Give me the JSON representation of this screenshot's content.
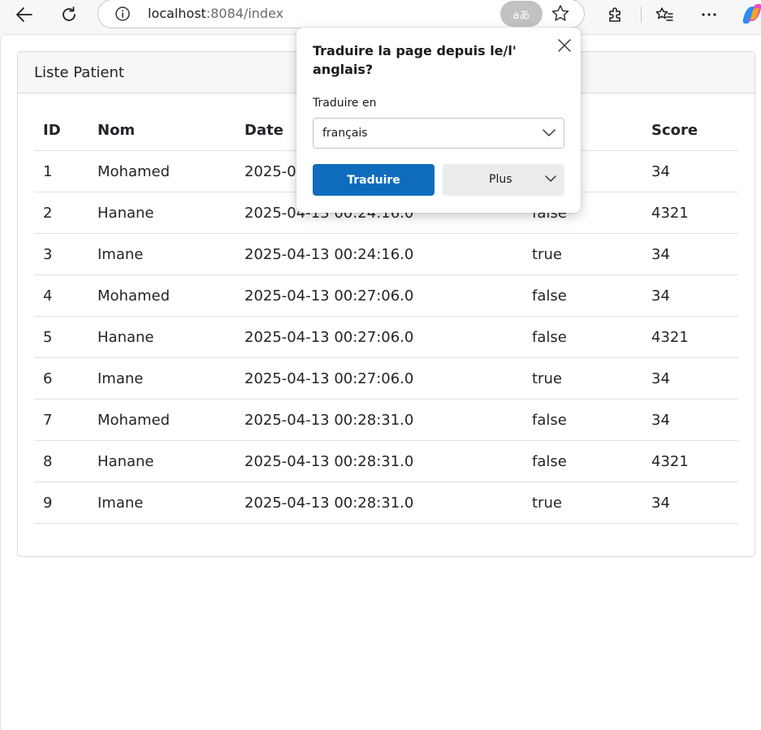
{
  "browser": {
    "url_host": "localhost",
    "url_rest": ":8084/index",
    "translate_badge": "aあ"
  },
  "card": {
    "title": "Liste Patient"
  },
  "table": {
    "headers": [
      "ID",
      "Nom",
      "Date",
      "",
      "Score"
    ],
    "rows": [
      [
        "1",
        "Mohamed",
        "2025-04",
        "",
        "34"
      ],
      [
        "2",
        "Hanane",
        "2025-04-13 00:24:16.0",
        "false",
        "4321"
      ],
      [
        "3",
        "Imane",
        "2025-04-13 00:24:16.0",
        "true",
        "34"
      ],
      [
        "4",
        "Mohamed",
        "2025-04-13 00:27:06.0",
        "false",
        "34"
      ],
      [
        "5",
        "Hanane",
        "2025-04-13 00:27:06.0",
        "false",
        "4321"
      ],
      [
        "6",
        "Imane",
        "2025-04-13 00:27:06.0",
        "true",
        "34"
      ],
      [
        "7",
        "Mohamed",
        "2025-04-13 00:28:31.0",
        "false",
        "34"
      ],
      [
        "8",
        "Hanane",
        "2025-04-13 00:28:31.0",
        "false",
        "4321"
      ],
      [
        "9",
        "Imane",
        "2025-04-13 00:28:31.0",
        "true",
        "34"
      ]
    ]
  },
  "translate_popup": {
    "title": "Traduire la page depuis le/l' anglais?",
    "label": "Traduire en",
    "selected_language": "français",
    "translate_button": "Traduire",
    "more_button": "Plus"
  },
  "colors": {
    "accent": "#0f6cbd",
    "header_bg": "#f7f7f7",
    "border": "#dee2e6"
  }
}
